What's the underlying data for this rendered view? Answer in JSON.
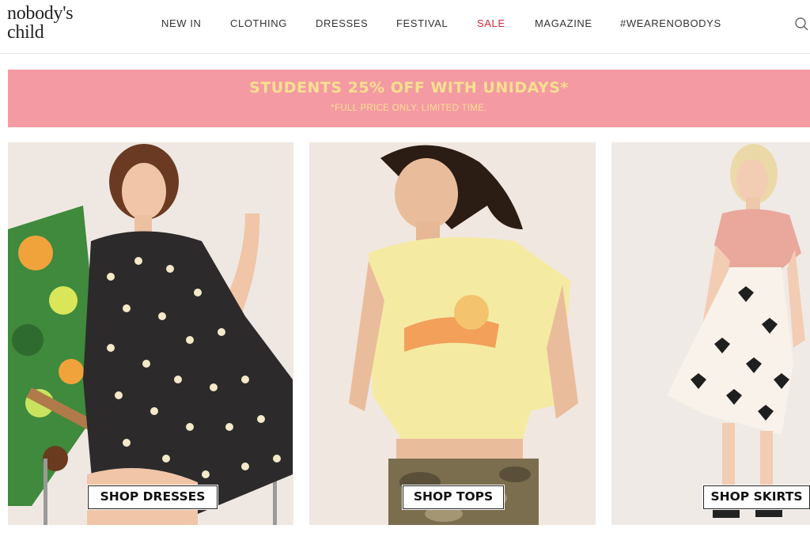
{
  "brand": {
    "logo_line1": "nobody's",
    "logo_line2": "child"
  },
  "nav": {
    "items": [
      {
        "label": "NEW IN"
      },
      {
        "label": "CLOTHING"
      },
      {
        "label": "DRESSES"
      },
      {
        "label": "FESTIVAL"
      },
      {
        "label": "SALE"
      },
      {
        "label": "MAGAZINE"
      },
      {
        "label": "#WEARENOBODYS"
      }
    ],
    "search_icon": "search-icon"
  },
  "banner": {
    "title": "STUDENTS 25% OFF WITH UNIDAYS*",
    "subtitle": "*FULL PRICE ONLY. LIMITED TIME."
  },
  "tiles": [
    {
      "cta": "SHOP DRESSES"
    },
    {
      "cta": "SHOP TOPS"
    },
    {
      "cta": "SHOP SKIRTS"
    }
  ],
  "colors": {
    "banner_bg": "#f49aa3",
    "banner_text": "#f8e08e",
    "sale": "#d02a3a",
    "photo_bg": "#efe7e1"
  }
}
